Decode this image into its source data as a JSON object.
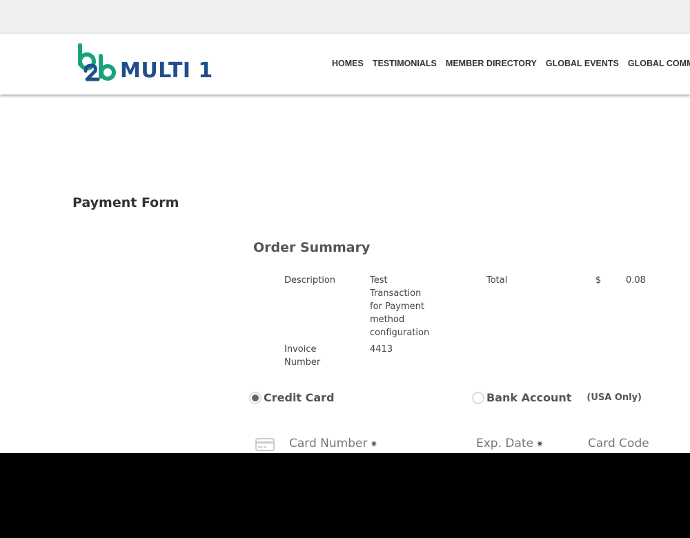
{
  "header": {
    "logo_text": "MULTI 1",
    "logo_mark": "b2b",
    "nav_items": [
      "HOMES",
      "TESTIMONIALS",
      "MEMBER DIRECTORY",
      "GLOBAL EVENTS",
      "GLOBAL COMM"
    ]
  },
  "page": {
    "title": "Payment Form"
  },
  "order_summary": {
    "title": "Order Summary",
    "description_label": "Description",
    "description_lines": [
      "Test",
      "Transaction",
      "for Payment",
      "method",
      "configuration"
    ],
    "total_label": "Total",
    "currency": "$",
    "total_value": "0.08",
    "invoice_label_lines": [
      "Invoice",
      "Number"
    ],
    "invoice_value": "4413"
  },
  "payment_method": {
    "credit_card_label": "Credit Card",
    "credit_card_selected": true,
    "bank_account_label": "Bank Account",
    "bank_account_note": "(USA Only)"
  },
  "card_fields": {
    "card_number_label": "Card Number",
    "exp_date_label": "Exp. Date",
    "card_code_label": "Card Code",
    "required_marker": "✷",
    "card_icon": "credit-card-icon"
  },
  "colors": {
    "logo_blue": "#1f4e8c",
    "logo_green": "#1aa37a",
    "top_strip": "#efefef"
  }
}
